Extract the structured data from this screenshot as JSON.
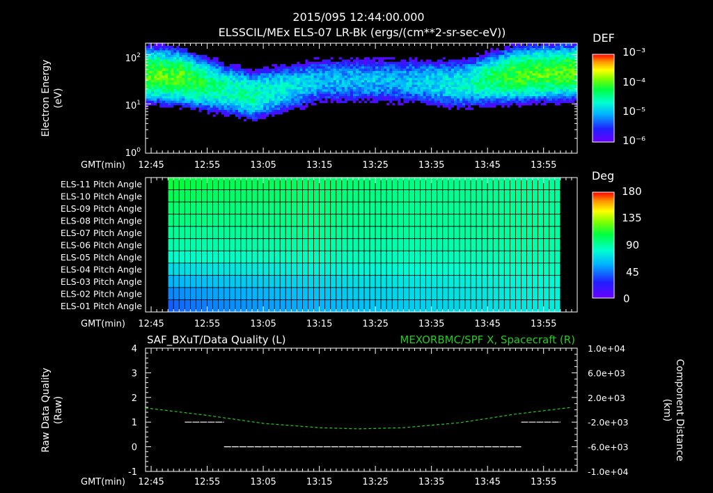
{
  "header": {
    "timestamp": "2015/095 12:44:00.000",
    "title": "ELSSCIL/MEx ELS-07 LR-Bk  (ergs/(cm**2-sr-sec-eV))"
  },
  "time_axis": {
    "label": "GMT(min)",
    "ticks": [
      "12:45",
      "12:55",
      "13:05",
      "13:15",
      "13:25",
      "13:35",
      "13:45",
      "13:55"
    ]
  },
  "panel1": {
    "ylabel_line1": "Electron Energy",
    "ylabel_line2": "(eV)",
    "colorbar_title": "DEF",
    "colorbar_ticks": [
      "10⁻³",
      "10⁻⁴",
      "10⁻⁵",
      "10⁻⁶"
    ]
  },
  "panel2": {
    "colorbar_title": "Deg",
    "colorbar_ticks": [
      "180",
      "135",
      "90",
      "45",
      "0"
    ]
  },
  "panel3": {
    "left_title": "SAF_BXuT/Data Quality (L)",
    "right_title": "MEXORBMC/SPF X, Spacecraft (R)",
    "left_ylabel_line1": "Raw Data Quality",
    "left_ylabel_line2": "(Raw)",
    "right_ylabel_line1": "Component Distance",
    "right_ylabel_line2": "(km)",
    "left_ticks": [
      "4",
      "3",
      "2",
      "1",
      "0",
      "-1"
    ],
    "right_ticks": [
      "1.0e+04",
      "6.0e+03",
      "2.0e+03",
      "-2.0e+03",
      "-6.0e+03",
      "-1.0e+04"
    ]
  },
  "colors": {
    "background": "#000000",
    "axes": "#ffffff",
    "spacecraft_line": "#22cc22",
    "quality_line": "#ffffff"
  },
  "chart_data": [
    {
      "type": "heatmap",
      "title": "ELSSCIL/MEx ELS-07 LR-Bk  (ergs/(cm**2-sr-sec-eV))",
      "xlabel": "GMT(min)",
      "ylabel": "Electron Energy (eV)",
      "y_scale": "log",
      "ylim": [
        1,
        170
      ],
      "xlim": [
        "12:44",
        "14:01"
      ],
      "y_tick_labels": [
        "10⁰",
        "10¹",
        "10²"
      ],
      "colorbar": {
        "label": "DEF",
        "scale": "log",
        "range": [
          1e-06,
          0.001
        ]
      },
      "energy_peak_by_time": [
        {
          "t": "12:44",
          "peak_eV": 40,
          "level": "1e-4"
        },
        {
          "t": "12:50",
          "peak_eV": 35,
          "level": "1e-4"
        },
        {
          "t": "12:58",
          "peak_eV": 20,
          "level": "3e-5"
        },
        {
          "t": "13:03",
          "peak_eV": 15,
          "level": "3e-5"
        },
        {
          "t": "13:15",
          "peak_eV": 30,
          "level": "1e-5"
        },
        {
          "t": "13:30",
          "peak_eV": 30,
          "level": "1e-5"
        },
        {
          "t": "13:40",
          "peak_eV": 25,
          "level": "2e-5"
        },
        {
          "t": "13:50",
          "peak_eV": 40,
          "level": "1e-4"
        },
        {
          "t": "14:00",
          "peak_eV": 45,
          "level": "1e-4"
        }
      ]
    },
    {
      "type": "heatmap",
      "xlabel": "GMT(min)",
      "colorbar": {
        "label": "Deg",
        "range": [
          0,
          180
        ]
      },
      "rows": [
        "ELS-11 Pitch Angle",
        "ELS-10 Pitch Angle",
        "ELS-09 Pitch Angle",
        "ELS-08 Pitch Angle",
        "ELS-07 Pitch Angle",
        "ELS-06 Pitch Angle",
        "ELS-05 Pitch Angle",
        "ELS-04 Pitch Angle",
        "ELS-03 Pitch Angle",
        "ELS-02 Pitch Angle",
        "ELS-01 Pitch Angle"
      ],
      "data_start": "12:48",
      "data_end": "13:58",
      "pitch_angle_start_deg": [
        110,
        105,
        100,
        97,
        92,
        88,
        82,
        70,
        58,
        48,
        40
      ],
      "pitch_angle_end_deg": [
        90,
        90,
        90,
        90,
        90,
        88,
        86,
        84,
        80,
        78,
        76
      ]
    },
    {
      "type": "line",
      "left_axis": {
        "label": "Raw Data Quality (Raw)",
        "ylim": [
          -1,
          4
        ]
      },
      "right_axis": {
        "label": "Component Distance (km)",
        "ylim": [
          -10000,
          10000
        ]
      },
      "series": [
        {
          "name": "SAF_BXuT/Data Quality (L)",
          "axis": "left",
          "segments": [
            {
              "x": [
                "12:51",
                "12:58"
              ],
              "y": [
                1,
                1
              ]
            },
            {
              "x": [
                "12:58",
                "13:51"
              ],
              "y": [
                0,
                0
              ]
            },
            {
              "x": [
                "13:51",
                "13:58"
              ],
              "y": [
                1,
                1
              ]
            }
          ]
        },
        {
          "name": "MEXORBMC/SPF X, Spacecraft (R)",
          "axis": "right",
          "x": [
            "12:44",
            "12:55",
            "13:05",
            "13:15",
            "13:22",
            "13:30",
            "13:40",
            "13:50",
            "14:00"
          ],
          "y": [
            300,
            -900,
            -2200,
            -2900,
            -3100,
            -2900,
            -2100,
            -700,
            400
          ]
        }
      ]
    }
  ]
}
